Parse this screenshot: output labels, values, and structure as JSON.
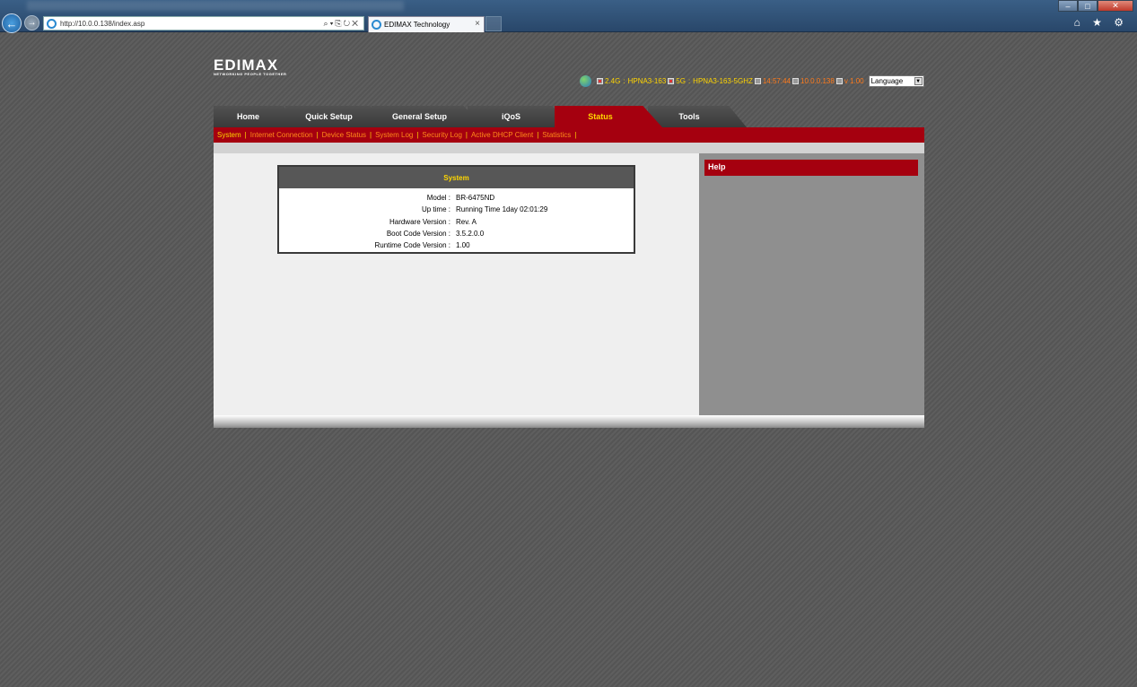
{
  "browser": {
    "address": "http://10.0.0.138/index.asp",
    "tab_title": "EDIMAX Technology",
    "tab_close": "×",
    "win_min": "–",
    "win_max": "□",
    "win_close": "✕",
    "tools_icons": "⌂ ★ ⚙"
  },
  "logo": {
    "text": "EDIMAX",
    "tagline": "NETWORKING PEOPLE TOGETHER"
  },
  "statusbar": {
    "band1": "2.4G",
    "sep1": ":",
    "ssid1": "HPNA3-163",
    "band2": "5G",
    "sep2": ":",
    "ssid2": "HPNA3-163-5GHZ",
    "time": "14:57:44",
    "ip": "10.0.0.138",
    "version": "v 1.00",
    "language": "Language"
  },
  "tabs": [
    {
      "label": "Home"
    },
    {
      "label": "Quick Setup"
    },
    {
      "label": "General Setup"
    },
    {
      "label": "iQoS"
    },
    {
      "label": "Status"
    },
    {
      "label": "Tools"
    }
  ],
  "subnav": [
    {
      "label": "System"
    },
    {
      "label": "Internet Connection"
    },
    {
      "label": "Device Status"
    },
    {
      "label": "System Log"
    },
    {
      "label": "Security Log"
    },
    {
      "label": "Active DHCP Client"
    },
    {
      "label": "Statistics"
    }
  ],
  "subnav_sep": "|",
  "system": {
    "title": "System",
    "rows": [
      {
        "label": "Model :",
        "value": "BR-6475ND"
      },
      {
        "label": "Up time :",
        "value": "Running Time 1day 02:01:29"
      },
      {
        "label": "Hardware Version :",
        "value": "Rev. A"
      },
      {
        "label": "Boot Code Version :",
        "value": "3.5.2.0.0"
      },
      {
        "label": "Runtime Code Version :",
        "value": "1.00"
      }
    ]
  },
  "help": {
    "title": "Help"
  },
  "colors": {
    "accent": "#a5000f",
    "highlight": "#ffd700",
    "link": "#ff8c1a"
  }
}
